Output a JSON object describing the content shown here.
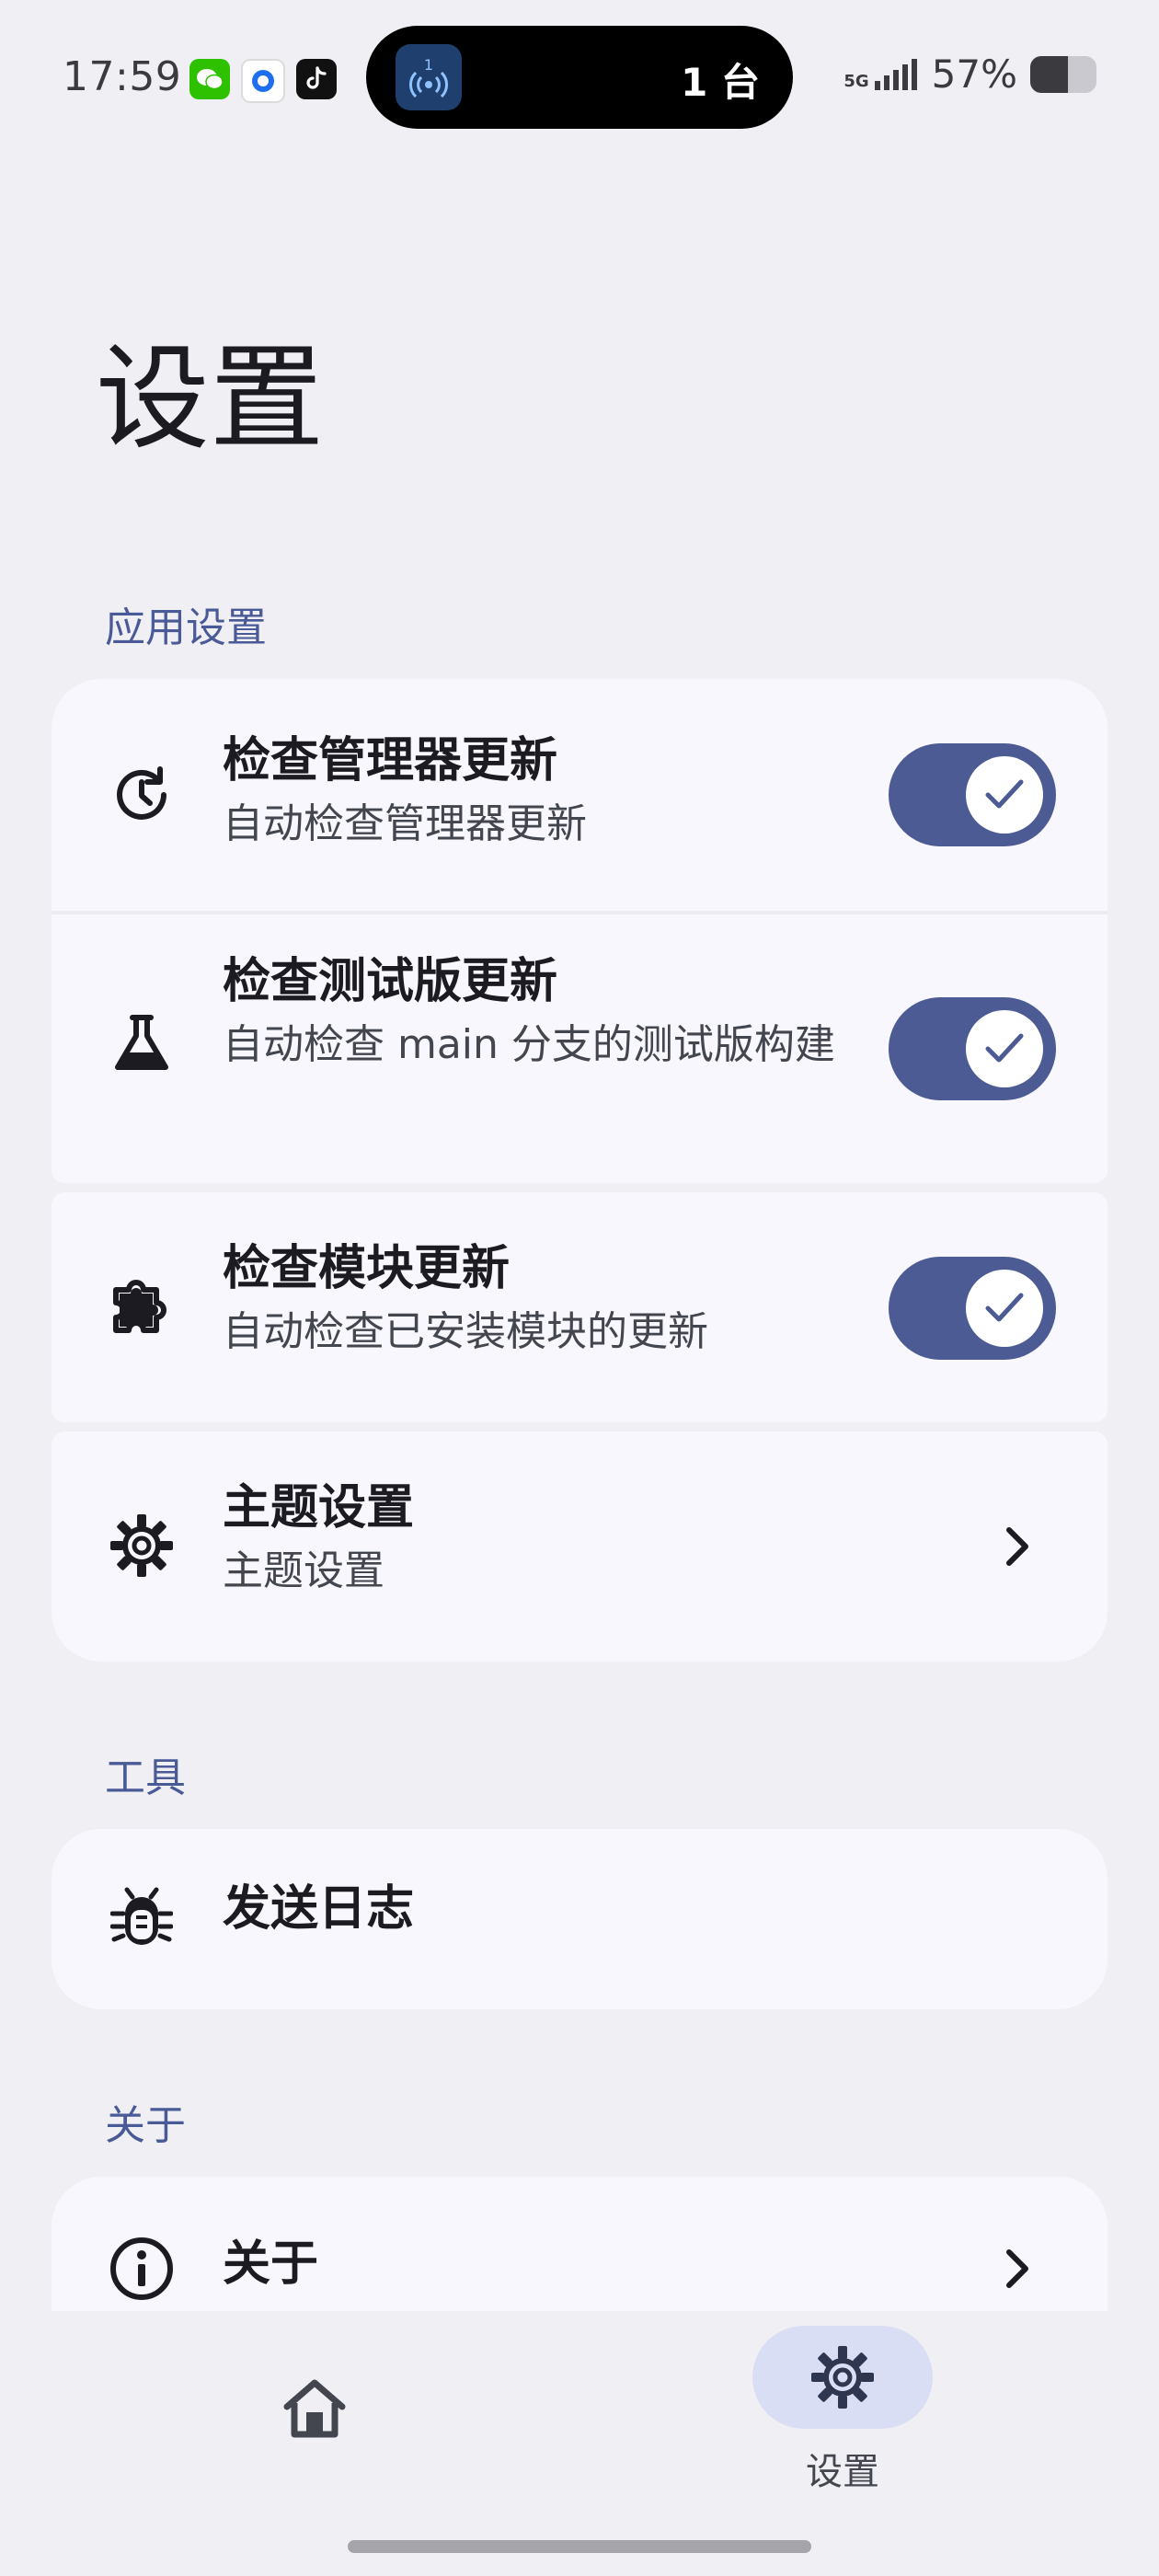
{
  "status_bar": {
    "time": "17:59",
    "island_text": "1 台",
    "island_badge": "1",
    "signal_label": "5G",
    "battery_percent": "57%",
    "battery_level": 0.57
  },
  "page": {
    "title": "设置"
  },
  "sections": {
    "app_settings": {
      "header": "应用设置",
      "items": [
        {
          "title": "检查管理器更新",
          "subtitle": "自动检查管理器更新",
          "icon": "update-clock-icon",
          "control": "toggle",
          "checked": true
        },
        {
          "title": "检查测试版更新",
          "subtitle": "自动检查 main 分支的测试版构建",
          "icon": "flask-icon",
          "control": "toggle",
          "checked": true
        },
        {
          "title": "检查模块更新",
          "subtitle": "自动检查已安装模块的更新",
          "icon": "puzzle-icon",
          "control": "toggle",
          "checked": true
        },
        {
          "title": "主题设置",
          "subtitle": "主题设置",
          "icon": "gear-icon",
          "control": "chevron"
        }
      ]
    },
    "tools": {
      "header": "工具",
      "items": [
        {
          "title": "发送日志",
          "icon": "bug-icon"
        }
      ]
    },
    "about": {
      "header": "关于",
      "items": [
        {
          "title": "关于",
          "icon": "info-icon",
          "control": "chevron"
        }
      ]
    }
  },
  "bottom_nav": {
    "items": [
      {
        "label": "",
        "icon": "home-icon",
        "selected": false
      },
      {
        "label": "设置",
        "icon": "gear-icon",
        "selected": true
      }
    ]
  },
  "colors": {
    "background": "#efeff4",
    "card": "#f7f7fd",
    "accent": "#4c5b94",
    "section_header": "#4a5a96",
    "nav_pill": "#d9def5"
  }
}
